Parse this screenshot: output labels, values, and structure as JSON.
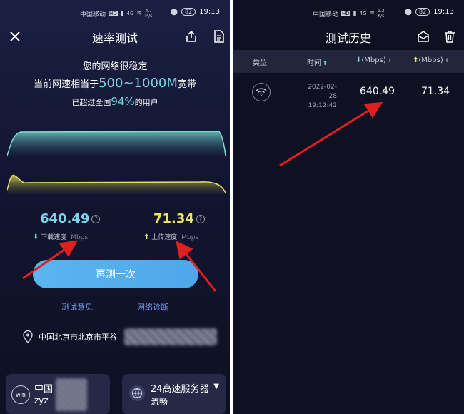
{
  "status_bar": {
    "carrier": "中国移动",
    "hd_tag": "HD",
    "signal_tag": "4G",
    "left_speed": {
      "value": "4.7",
      "unit": "M/s"
    },
    "right_speed": {
      "value": "1.2",
      "unit": "K/s"
    },
    "battery": "82",
    "time": "19:13"
  },
  "left_screen": {
    "title": "速率测试",
    "headline": "您的网络很稳定",
    "equivalent": {
      "prefix": "当前网速相当于",
      "range": "500~1000M",
      "suffix": "宽带"
    },
    "exceed": {
      "prefix": "已超过全国",
      "percent": "94%",
      "suffix": "的用户"
    },
    "download": {
      "value": "640.49",
      "label": "下载速度",
      "unit": "Mbps"
    },
    "upload": {
      "value": "71.34",
      "label": "上传速度",
      "unit": "Mbps"
    },
    "retest_label": "再测一次",
    "feedback_label": "测试意见",
    "diagnose_label": "网络诊断",
    "location": "中国北京市北京市平谷",
    "network_card": {
      "badge": "wifi",
      "line1": "中国",
      "line2": "zyz"
    },
    "server_card": {
      "name": "24高速服务器",
      "status": "流畅"
    }
  },
  "right_screen": {
    "title": "测试历史",
    "columns": {
      "type": "类型",
      "time": "时间",
      "download_unit": "(Mbps)",
      "upload_unit": "(Mbps)"
    },
    "rows": [
      {
        "date": "2022-02-28",
        "time": "19:12:42",
        "download": "640.49",
        "upload": "71.34"
      }
    ]
  },
  "colors": {
    "accent_cyan": "#6fd4e0",
    "upload_yellow": "#eee35a",
    "button_blue": "#52adec",
    "link_blue": "#6f9ff0",
    "annotation_red": "#e02020"
  }
}
